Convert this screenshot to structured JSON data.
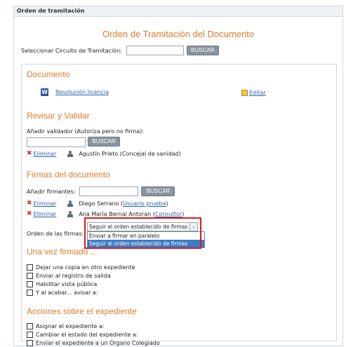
{
  "panel": {
    "title": "Orden de tramitación"
  },
  "main_title": "Orden de Tramitación del Documento",
  "circuit": {
    "label": "Seleccionar Circuito de Tramitación:",
    "value": "",
    "button": "BUSCAR"
  },
  "documento": {
    "title": "Documento",
    "file_link": "Resolución licencia",
    "edit_link": "Editar"
  },
  "revisar": {
    "title": "Revisar y Validar",
    "add_label": "Añadir validador (Autoriza pero no firma):",
    "value": "",
    "button": "BUSCAR",
    "items": [
      {
        "remove": "Eliminar",
        "name": "Agustín Prieto (Concejal de sanidad)"
      }
    ]
  },
  "firmas": {
    "title": "Firmas del documento",
    "add_label": "Añadir firmantes:",
    "value": "",
    "button": "BUSCAR",
    "items": [
      {
        "remove": "Eliminar",
        "name": "Diego Serrano (",
        "role": "Usuario prueba",
        "close": ")"
      },
      {
        "remove": "Eliminar",
        "name": "Ana María Bernal Antoran (",
        "role": "Consultor",
        "close": ")"
      }
    ],
    "order_label": "Orden de las firmas:",
    "order_selected": "Seguir el orden establecido de firmas",
    "order_options": [
      "Enviar a firmar en paralelo",
      "Seguir el orden establecido de firmas"
    ]
  },
  "una_vez": {
    "title": "Una vez firmado ...",
    "checks": [
      "Dejar una copia en otro expediente",
      "Enviar al registro de salida",
      "Habilitar vista pública",
      "Y al acabar... avisar a:"
    ]
  },
  "acciones": {
    "title": "Acciones sobre el expediente",
    "checks": [
      "Asignar el expediente a:",
      "Cambiar el estado del expediente a:",
      "Enviar el expediente a un Órgano Colegiado"
    ]
  },
  "colors": {
    "accent": "#e07b2a",
    "link": "#2a63b0",
    "button": "#8a949f",
    "highlight": "#e01a1a"
  }
}
